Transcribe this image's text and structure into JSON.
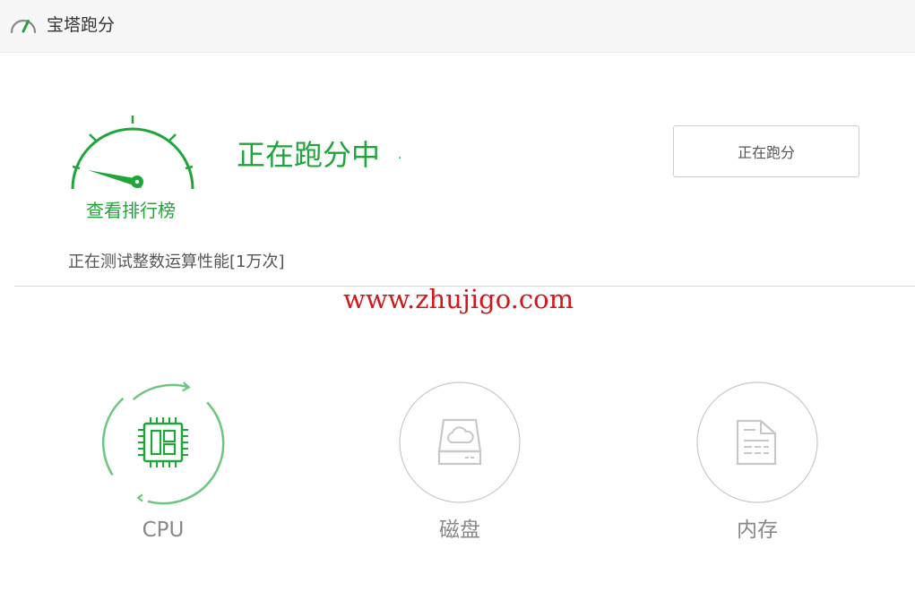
{
  "header": {
    "title": "宝塔跑分",
    "icon": "speedometer-icon"
  },
  "gauge": {
    "ranking_link": "查看排行榜",
    "icon": "speedometer-gauge-icon",
    "color": "#20a53a"
  },
  "status": {
    "title": "正在跑分中",
    "dot": "·",
    "button_label": "正在跑分",
    "test_info": "正在测试整数运算性能[1万次]"
  },
  "watermark": "www.zhujigo.com",
  "modules": [
    {
      "label": "CPU",
      "icon": "cpu-chip-icon",
      "state": "active"
    },
    {
      "label": "磁盘",
      "icon": "disk-drive-icon",
      "state": "pending"
    },
    {
      "label": "内存",
      "icon": "memory-document-icon",
      "state": "pending"
    }
  ],
  "colors": {
    "accent": "#20a53a",
    "accent_light": "#6cc680",
    "watermark": "#d4181a",
    "inactive": "#c8c8cc"
  }
}
